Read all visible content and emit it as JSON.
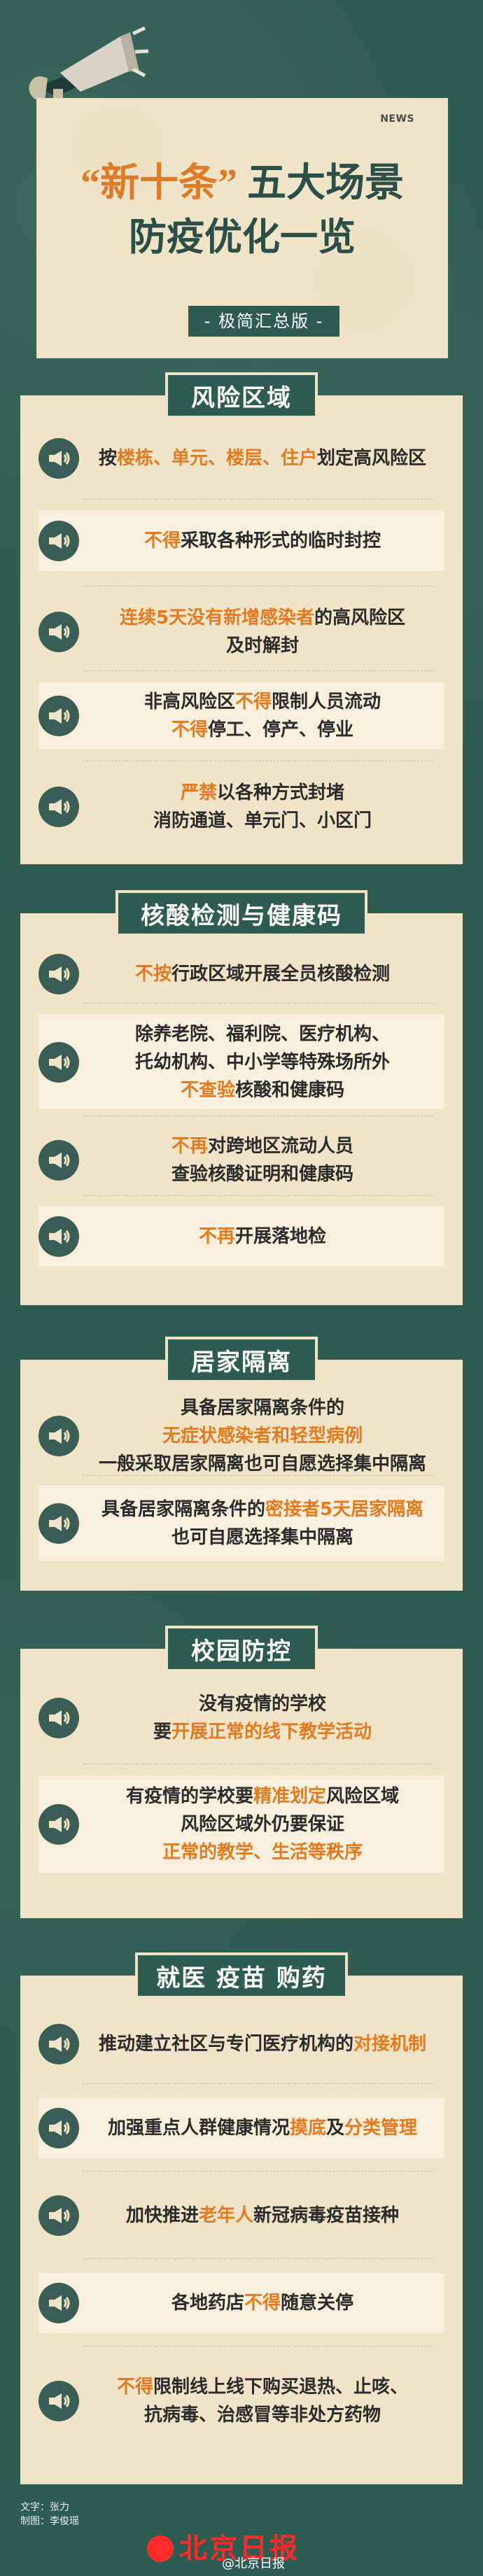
{
  "colors": {
    "background": "#2f5c51",
    "card": "#efe4c8",
    "accent": "#e37a1f",
    "title": "#2b4f47",
    "logo_red": "#ff2a2a",
    "icon_bg": "#3a5e55"
  },
  "hero": {
    "news_tag": "NEWS",
    "title_part_quote": "“新十条”",
    "title_part_rest": "五大场景",
    "title_line2": "防疫优化一览",
    "subtitle": "- 极简汇总版 -",
    "icon": "megaphone-icon"
  },
  "sections": [
    {
      "title": "风险区域",
      "rows": [
        {
          "icon": "speaker-icon",
          "parts": [
            {
              "text": "按",
              "accent": false
            },
            {
              "text": "楼栋、单元、楼层、住户",
              "accent": true
            },
            {
              "text": "划定高风险区",
              "accent": false
            }
          ]
        },
        {
          "icon": "speaker-icon",
          "parts": [
            {
              "text": "不得",
              "accent": true
            },
            {
              "text": "采取各种形式的临时封控",
              "accent": false
            }
          ]
        },
        {
          "icon": "speaker-icon",
          "parts": [
            {
              "text": "连续5天没有新增感染者",
              "accent": true
            },
            {
              "text": "的高风险区",
              "accent": false
            },
            {
              "text": "\n及时解封",
              "accent": false
            }
          ]
        },
        {
          "icon": "speaker-icon",
          "parts": [
            {
              "text": "非高风险区",
              "accent": false
            },
            {
              "text": "不得",
              "accent": true
            },
            {
              "text": "限制人员流动",
              "accent": false
            },
            {
              "text": "\n",
              "accent": false
            },
            {
              "text": "不得",
              "accent": true
            },
            {
              "text": "停工、停产、停业",
              "accent": false
            }
          ]
        },
        {
          "icon": "speaker-icon",
          "parts": [
            {
              "text": "严禁",
              "accent": true
            },
            {
              "text": "以各种方式封堵",
              "accent": false
            },
            {
              "text": "\n消防通道、单元门、小区门",
              "accent": false
            }
          ]
        }
      ]
    },
    {
      "title": "核酸检测与健康码",
      "rows": [
        {
          "icon": "speaker-icon",
          "parts": [
            {
              "text": "不按",
              "accent": true
            },
            {
              "text": "行政区域开展全员核酸检测",
              "accent": false
            }
          ]
        },
        {
          "icon": "speaker-icon",
          "parts": [
            {
              "text": "除养老院、福利院、医疗机构、",
              "accent": false
            },
            {
              "text": "\n托幼机构、中小学等特殊场所外",
              "accent": false
            },
            {
              "text": "\n",
              "accent": false
            },
            {
              "text": "不查验",
              "accent": true
            },
            {
              "text": "核酸和健康码",
              "accent": false
            }
          ]
        },
        {
          "icon": "speaker-icon",
          "parts": [
            {
              "text": "不再",
              "accent": true
            },
            {
              "text": "对跨地区流动人员",
              "accent": false
            },
            {
              "text": "\n查验核酸证明和健康码",
              "accent": false
            }
          ]
        },
        {
          "icon": "speaker-icon",
          "parts": [
            {
              "text": "不再",
              "accent": true
            },
            {
              "text": "开展落地检",
              "accent": false
            }
          ]
        }
      ]
    },
    {
      "title": "居家隔离",
      "rows": [
        {
          "icon": "speaker-icon",
          "parts": [
            {
              "text": "具备居家隔离条件的",
              "accent": false
            },
            {
              "text": "\n",
              "accent": false
            },
            {
              "text": "无症状感染者和轻型病例",
              "accent": true
            },
            {
              "text": "\n一般采取居家隔离也可自愿选择集中隔离",
              "accent": false
            }
          ]
        },
        {
          "icon": "speaker-icon",
          "parts": [
            {
              "text": "具备居家隔离条件的",
              "accent": false
            },
            {
              "text": "密接者5天居家隔离",
              "accent": true
            },
            {
              "text": "\n也可自愿选择集中隔离",
              "accent": false
            }
          ]
        }
      ]
    },
    {
      "title": "校园防控",
      "rows": [
        {
          "icon": "speaker-icon",
          "parts": [
            {
              "text": "没有疫情的学校",
              "accent": false
            },
            {
              "text": "\n要",
              "accent": false
            },
            {
              "text": "开展正常的线下教学活动",
              "accent": true
            }
          ]
        },
        {
          "icon": "speaker-icon",
          "parts": [
            {
              "text": "有疫情的学校要",
              "accent": false
            },
            {
              "text": "精准划定",
              "accent": true
            },
            {
              "text": "风险区域",
              "accent": false
            },
            {
              "text": "\n风险区域外仍要保证",
              "accent": false
            },
            {
              "text": "\n",
              "accent": false
            },
            {
              "text": "正常的教学、生活等秩序",
              "accent": true
            }
          ]
        }
      ]
    },
    {
      "title": "就医 疫苗 购药",
      "rows": [
        {
          "icon": "speaker-icon",
          "parts": [
            {
              "text": "推动建立社区与专门医疗机构的",
              "accent": false
            },
            {
              "text": "对接机制",
              "accent": true
            }
          ]
        },
        {
          "icon": "speaker-icon",
          "parts": [
            {
              "text": "加强重点人群健康情况",
              "accent": false
            },
            {
              "text": "摸底",
              "accent": true
            },
            {
              "text": "及",
              "accent": false
            },
            {
              "text": "分类管理",
              "accent": true
            }
          ]
        },
        {
          "icon": "speaker-icon",
          "parts": [
            {
              "text": "加快推进",
              "accent": false
            },
            {
              "text": "老年人",
              "accent": true
            },
            {
              "text": "新冠病毒疫苗接种",
              "accent": false
            }
          ]
        },
        {
          "icon": "speaker-icon",
          "parts": [
            {
              "text": "各地药店",
              "accent": false
            },
            {
              "text": "不得",
              "accent": true
            },
            {
              "text": "随意关停",
              "accent": false
            }
          ]
        },
        {
          "icon": "speaker-icon",
          "parts": [
            {
              "text": "不得",
              "accent": true
            },
            {
              "text": "限制线上线下购买退热、止咳、",
              "accent": false
            },
            {
              "text": "\n抗病毒、治感冒等非处方药物",
              "accent": false
            }
          ]
        }
      ]
    }
  ],
  "credits": {
    "text_line": "文字：张力",
    "design_line": "制图：李俊瑶"
  },
  "footer": {
    "logo_text": "北京日报",
    "weibo_tag": "@北京日报"
  }
}
